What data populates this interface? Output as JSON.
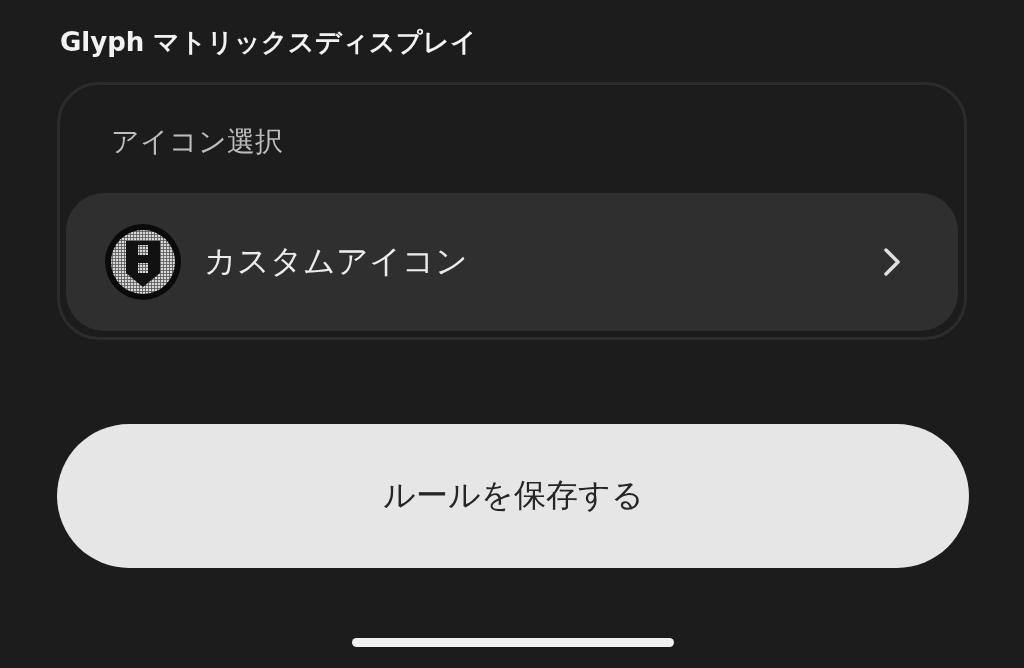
{
  "section_title": "Glyph マトリックスディスプレイ",
  "card": {
    "label": "アイコン選択",
    "item": {
      "label": "カスタムアイコン"
    }
  },
  "save_button": {
    "label": "ルールを保存する"
  }
}
